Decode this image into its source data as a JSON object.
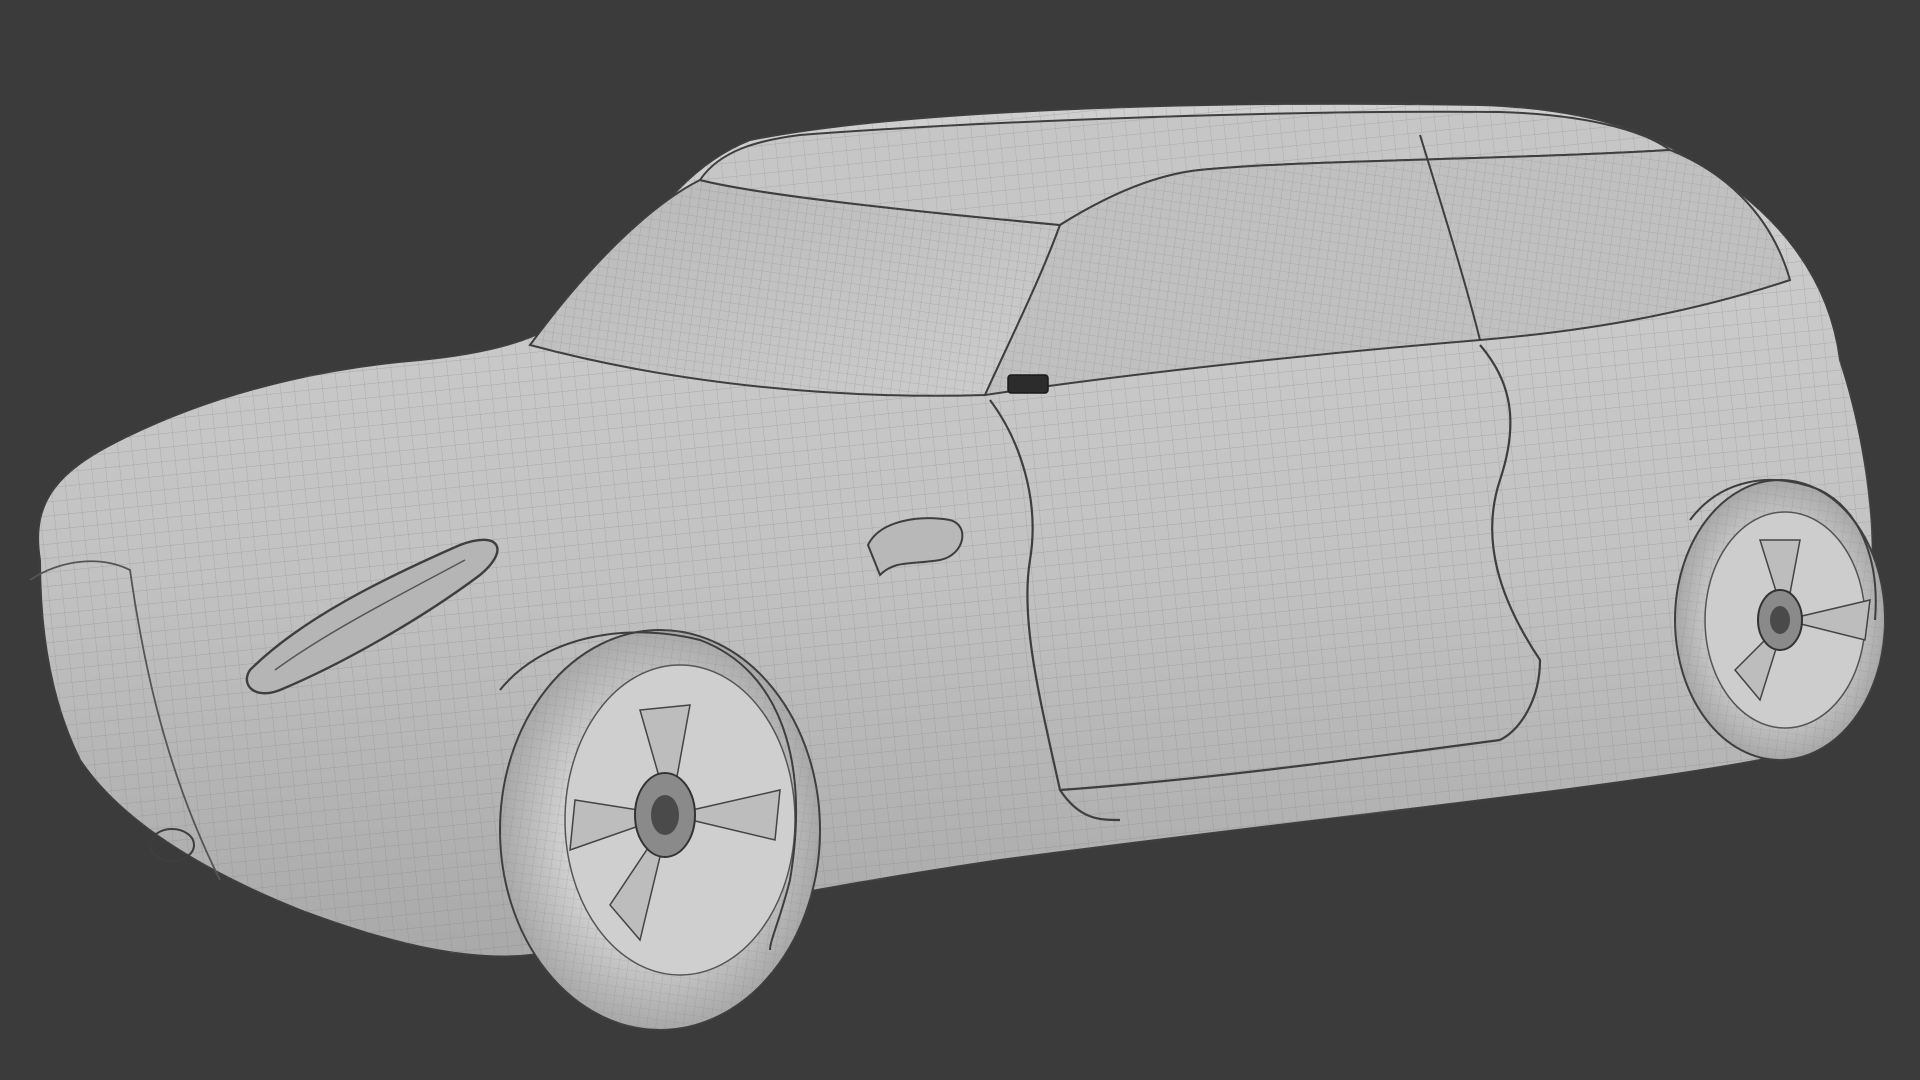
{
  "viewport": {
    "background_color": "#3b3b3b",
    "subject": "car-wireframe-model",
    "shading": "solid-gray-with-wireframe-overlay",
    "colors": {
      "body": "#c4c4c4",
      "body_shadow": "#9a9a9a",
      "body_highlight": "#d6d6d6",
      "wire": "#7e7e7e",
      "crease": "#3e3e3e",
      "tire": "#bdbdbd",
      "rim": "#cfcfcf",
      "hub": "#5a5a5a"
    }
  }
}
